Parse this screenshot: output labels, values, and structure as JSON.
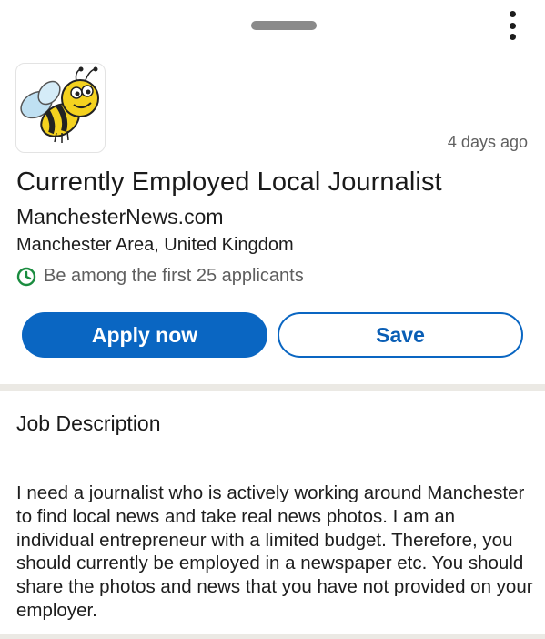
{
  "sheet": {
    "handle_icon": "drag-handle",
    "more_icon": "more-vertical-icon"
  },
  "job": {
    "logo_icon": "bee-logo",
    "posted": "4 days ago",
    "title": "Currently Employed Local Journalist",
    "company": "ManchesterNews.com",
    "location": "Manchester Area, United Kingdom",
    "applicants_icon": "clock-icon",
    "applicants": "Be among the first 25 applicants"
  },
  "actions": {
    "apply_label": "Apply now",
    "save_label": "Save"
  },
  "description": {
    "heading": "Job Description",
    "body": "I need a journalist who is actively working around Manchester to find local news and take real news photos. I am an individual entrepreneur with a limited budget. Therefore, you should currently be employed in a newspaper etc. You should share the photos and news that you have not provided on your employer."
  },
  "colors": {
    "accent": "#0a66c2",
    "status_green": "#1a8c3f",
    "divider": "#ebe9e4"
  }
}
